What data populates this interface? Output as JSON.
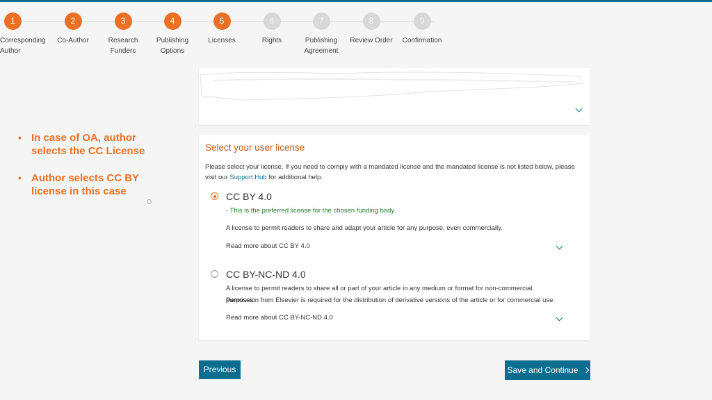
{
  "stepper": {
    "steps": [
      {
        "number": "1",
        "label": "Corresponding Author",
        "state": "done"
      },
      {
        "number": "2",
        "label": "Co-Author",
        "state": "done"
      },
      {
        "number": "3",
        "label": "Research Funders",
        "state": "done"
      },
      {
        "number": "4",
        "label": "Publishing Options",
        "state": "done"
      },
      {
        "number": "5",
        "label": "Licenses",
        "state": "current"
      },
      {
        "number": "6",
        "label": "Rights",
        "state": "todo"
      },
      {
        "number": "7",
        "label": "Publishing Agreement",
        "state": "todo"
      },
      {
        "number": "8",
        "label": "Review Order",
        "state": "todo"
      },
      {
        "number": "9",
        "label": "Confirmation",
        "state": "todo"
      }
    ]
  },
  "annotation": {
    "bullet1": "In case of OA, author selects the CC License",
    "bullet2": "Author selects CC BY license in this case"
  },
  "license_section": {
    "title": "Select your user license",
    "intro_before_link": "Please select your license. If you need to comply with a mandated license and the mandated license is not listed below, please visit our ",
    "intro_link": "Support Hub",
    "intro_after_link": " for additional help.",
    "options": [
      {
        "title": "CC BY 4.0",
        "selected": true,
        "note": "- This is the preferred license for the chosen funding body.",
        "description": "A license to permit readers to share and adapt your article for any purpose, even commercially.",
        "read_more": "Read more about CC BY 4.0"
      },
      {
        "title": "CC BY-NC-ND 4.0",
        "selected": false,
        "description": "A license to permit readers to share all or part of your article in any medium or format for non-commercial purposes.",
        "description2": "Permission from Elsevier is required for the distribution of derivative versions of the article or for commercial use.",
        "read_more": "Read more about CC BY-NC-ND 4.0"
      }
    ]
  },
  "buttons": {
    "previous": "Previous",
    "save_continue": "Save and Continue"
  },
  "colors": {
    "accent": "#eb6f24",
    "primary": "#0c6e8f",
    "note_green": "#1f7a2c"
  }
}
